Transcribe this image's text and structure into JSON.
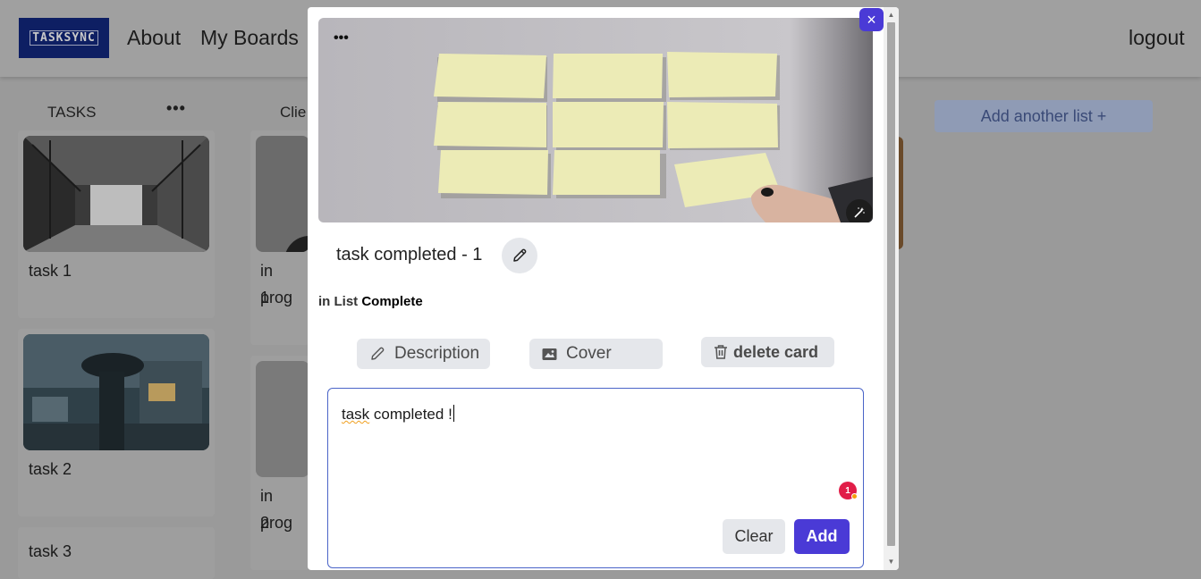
{
  "navbar": {
    "logo_text": "TASKSYNC",
    "links": [
      "About",
      "My Boards"
    ],
    "logout": "logout"
  },
  "board": {
    "lists": [
      {
        "title": "TASKS",
        "menu": "•••",
        "cards": [
          "task 1",
          "task 2",
          "task 3"
        ]
      },
      {
        "title": "Clie",
        "cards": [
          "in prog 1",
          "in prog 2"
        ],
        "card_lines": [
          [
            "in prog",
            "1"
          ],
          [
            "in prog",
            "2"
          ]
        ]
      }
    ],
    "add_list": "Add another list  +"
  },
  "modal": {
    "cover_menu": "•••",
    "card_title": "task completed - 1",
    "in_list_prefix": "in List",
    "list_name": "Complete",
    "buttons": {
      "description": "Description",
      "cover": "Cover",
      "delete": "delete card"
    },
    "editor": {
      "text_spell": "task",
      "text_rest": " completed !",
      "badge": "1"
    },
    "clear": "Clear",
    "add": "Add",
    "close_icon": "×"
  },
  "colors": {
    "accent": "#4a3ad6",
    "logo_bg": "#0e1f63",
    "badge": "#e11d48"
  }
}
